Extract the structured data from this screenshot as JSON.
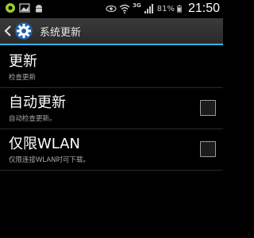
{
  "status_bar": {
    "icons_left": [
      "notification-icon",
      "image-icon",
      "android-icon"
    ],
    "network": "3G",
    "battery": "81%",
    "time": "21:50"
  },
  "action_bar": {
    "title": "系统更新",
    "accent": "#33b5e5"
  },
  "preferences": [
    {
      "title": "更新",
      "summary": "检查更新",
      "has_checkbox": false,
      "checked": false
    },
    {
      "title": "自动更新",
      "summary": "自动检查更新。",
      "has_checkbox": true,
      "checked": false
    },
    {
      "title": "仅限WLAN",
      "summary": "仅限连接WLAN时可下载。",
      "has_checkbox": true,
      "checked": false
    }
  ]
}
